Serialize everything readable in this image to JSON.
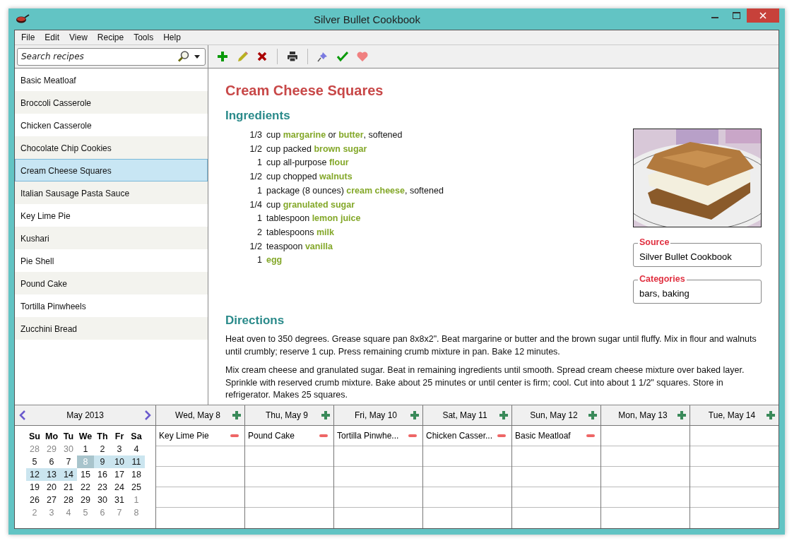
{
  "window": {
    "title": "Silver Bullet Cookbook"
  },
  "menu": [
    "File",
    "Edit",
    "View",
    "Recipe",
    "Tools",
    "Help"
  ],
  "search": {
    "placeholder": "Search recipes"
  },
  "toolbar": [
    {
      "kind": "add"
    },
    {
      "kind": "edit"
    },
    {
      "kind": "delete"
    },
    {
      "kind": "separator"
    },
    {
      "kind": "print"
    },
    {
      "kind": "separator"
    },
    {
      "kind": "pin"
    },
    {
      "kind": "check"
    },
    {
      "kind": "favorite"
    }
  ],
  "recipes": [
    {
      "name": "Basic Meatloaf",
      "selected": false
    },
    {
      "name": "Broccoli Casserole",
      "selected": false
    },
    {
      "name": "Chicken Casserole",
      "selected": false
    },
    {
      "name": "Chocolate Chip Cookies",
      "selected": false
    },
    {
      "name": "Cream Cheese Squares",
      "selected": true
    },
    {
      "name": "Italian Sausage Pasta Sauce",
      "selected": false
    },
    {
      "name": "Key Lime Pie",
      "selected": false
    },
    {
      "name": "Kushari",
      "selected": false
    },
    {
      "name": "Pie Shell",
      "selected": false
    },
    {
      "name": "Pound Cake",
      "selected": false
    },
    {
      "name": "Tortilla Pinwheels",
      "selected": false
    },
    {
      "name": "Zucchini Bread",
      "selected": false
    }
  ],
  "recipe": {
    "title": "Cream Cheese Squares",
    "ingredients_heading": "Ingredients",
    "ingredients": [
      {
        "amount": "1/3",
        "text": "cup **margarine** or **butter**, softened"
      },
      {
        "amount": "1/2",
        "text": "cup packed **brown sugar**"
      },
      {
        "amount": "1",
        "text": "cup all-purpose **flour**"
      },
      {
        "amount": "1/2",
        "text": "cup chopped **walnuts**"
      },
      {
        "amount": "1",
        "text": "package (8 ounces) **cream cheese**, softened"
      },
      {
        "amount": "1/4",
        "text": "cup **granulated sugar**"
      },
      {
        "amount": "1",
        "text": "tablespoon **lemon juice**"
      },
      {
        "amount": "2",
        "text": "tablespoons **milk**"
      },
      {
        "amount": "1/2",
        "text": "teaspoon **vanilla**"
      },
      {
        "amount": "1",
        "text": "**egg**"
      }
    ],
    "directions_heading": "Directions",
    "directions": [
      "Heat oven to 350 degrees. Grease square pan 8x8x2\". Beat margarine or butter and the brown sugar until fluffy. Mix in flour and walnuts until crumbly; reserve 1 cup. Press remaining crumb mixture in pan. Bake 12 minutes.",
      "Mix cream cheese and granulated sugar. Beat in remaining ingredients until smooth. Spread cream cheese mixture over baked layer. Sprinkle with reserved crumb mixture. Bake about 25 minutes or until center is firm; cool. Cut into about 1 1/2\" squares. Store in refrigerator. Makes 25 squares."
    ],
    "source": {
      "label": "Source",
      "value": "Silver Bullet Cookbook"
    },
    "categories": {
      "label": "Categories",
      "value": "bars, baking"
    }
  },
  "calendar": {
    "month": "May 2013",
    "weekdays": [
      "Su",
      "Mo",
      "Tu",
      "We",
      "Th",
      "Fr",
      "Sa"
    ],
    "weeks": [
      [
        {
          "d": "28",
          "muted": true,
          "selected": false,
          "in_range": false
        },
        {
          "d": "29",
          "muted": true,
          "selected": false,
          "in_range": false
        },
        {
          "d": "30",
          "muted": true,
          "selected": false,
          "in_range": false
        },
        {
          "d": "1",
          "muted": false,
          "selected": false,
          "in_range": false
        },
        {
          "d": "2",
          "muted": false,
          "selected": false,
          "in_range": false
        },
        {
          "d": "3",
          "muted": false,
          "selected": false,
          "in_range": false
        },
        {
          "d": "4",
          "muted": false,
          "selected": false,
          "in_range": false
        }
      ],
      [
        {
          "d": "5",
          "muted": false,
          "selected": false,
          "in_range": false
        },
        {
          "d": "6",
          "muted": false,
          "selected": false,
          "in_range": false
        },
        {
          "d": "7",
          "muted": false,
          "selected": false,
          "in_range": false
        },
        {
          "d": "8",
          "muted": false,
          "selected": true,
          "in_range": true
        },
        {
          "d": "9",
          "muted": false,
          "selected": false,
          "in_range": true
        },
        {
          "d": "10",
          "muted": false,
          "selected": false,
          "in_range": true
        },
        {
          "d": "11",
          "muted": false,
          "selected": false,
          "in_range": true
        }
      ],
      [
        {
          "d": "12",
          "muted": false,
          "selected": false,
          "in_range": true
        },
        {
          "d": "13",
          "muted": false,
          "selected": false,
          "in_range": true
        },
        {
          "d": "14",
          "muted": false,
          "selected": false,
          "in_range": true
        },
        {
          "d": "15",
          "muted": false,
          "selected": false,
          "in_range": false
        },
        {
          "d": "16",
          "muted": false,
          "selected": false,
          "in_range": false
        },
        {
          "d": "17",
          "muted": false,
          "selected": false,
          "in_range": false
        },
        {
          "d": "18",
          "muted": false,
          "selected": false,
          "in_range": false
        }
      ],
      [
        {
          "d": "19",
          "muted": false,
          "selected": false,
          "in_range": false
        },
        {
          "d": "20",
          "muted": false,
          "selected": false,
          "in_range": false
        },
        {
          "d": "21",
          "muted": false,
          "selected": false,
          "in_range": false
        },
        {
          "d": "22",
          "muted": false,
          "selected": false,
          "in_range": false
        },
        {
          "d": "23",
          "muted": false,
          "selected": false,
          "in_range": false
        },
        {
          "d": "24",
          "muted": false,
          "selected": false,
          "in_range": false
        },
        {
          "d": "25",
          "muted": false,
          "selected": false,
          "in_range": false
        }
      ],
      [
        {
          "d": "26",
          "muted": false,
          "selected": false,
          "in_range": false
        },
        {
          "d": "27",
          "muted": false,
          "selected": false,
          "in_range": false
        },
        {
          "d": "28",
          "muted": false,
          "selected": false,
          "in_range": false
        },
        {
          "d": "29",
          "muted": false,
          "selected": false,
          "in_range": false
        },
        {
          "d": "30",
          "muted": false,
          "selected": false,
          "in_range": false
        },
        {
          "d": "31",
          "muted": false,
          "selected": false,
          "in_range": false
        },
        {
          "d": "1",
          "muted": true,
          "selected": false,
          "in_range": false
        }
      ],
      [
        {
          "d": "2",
          "muted": true,
          "selected": false,
          "in_range": false
        },
        {
          "d": "3",
          "muted": true,
          "selected": false,
          "in_range": false
        },
        {
          "d": "4",
          "muted": true,
          "selected": false,
          "in_range": false
        },
        {
          "d": "5",
          "muted": true,
          "selected": false,
          "in_range": false
        },
        {
          "d": "6",
          "muted": true,
          "selected": false,
          "in_range": false
        },
        {
          "d": "7",
          "muted": true,
          "selected": false,
          "in_range": false
        },
        {
          "d": "8",
          "muted": true,
          "selected": false,
          "in_range": false
        }
      ]
    ]
  },
  "planner": [
    {
      "day": "Wed, May 8",
      "meals": [
        "Key Lime Pie"
      ]
    },
    {
      "day": "Thu, May 9",
      "meals": [
        "Pound Cake"
      ]
    },
    {
      "day": "Fri, May 10",
      "meals": [
        "Tortilla Pinwhe..."
      ]
    },
    {
      "day": "Sat, May 11",
      "meals": [
        "Chicken Casser..."
      ]
    },
    {
      "day": "Sun, May 12",
      "meals": [
        "Basic Meatloaf"
      ]
    },
    {
      "day": "Mon, May 13"
    },
    {
      "day": "Tue, May 14"
    }
  ]
}
